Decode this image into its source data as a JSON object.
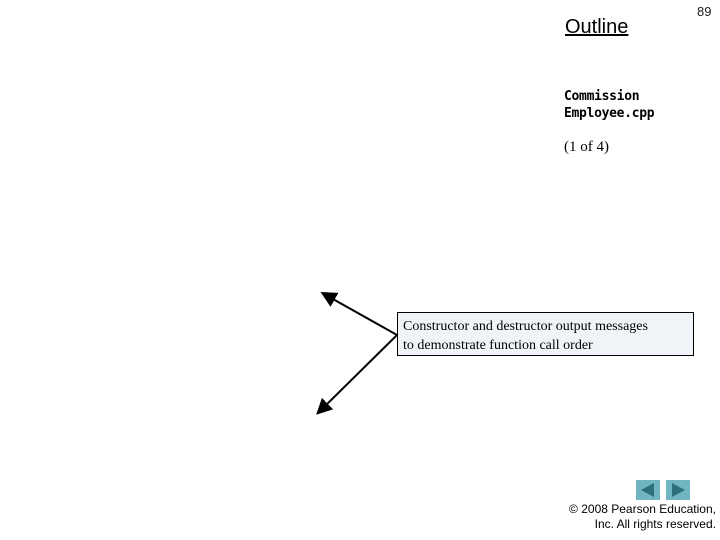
{
  "outline": {
    "title": "Outline"
  },
  "page_number": "89",
  "file": {
    "line1": "Commission",
    "line2": "Employee.cpp",
    "part": "(1 of 4)"
  },
  "callout": {
    "text_line1": "Constructor and destructor output messages",
    "text_line2": "to demonstrate function call order"
  },
  "nav": {
    "prev_icon": "triangle-left-icon",
    "next_icon": "triangle-right-icon",
    "color": "#6fb6c2",
    "glyph_color": "#2e6f7a"
  },
  "footer": {
    "line1": "© 2008 Pearson Education,",
    "line2": "Inc.  All rights reserved."
  }
}
